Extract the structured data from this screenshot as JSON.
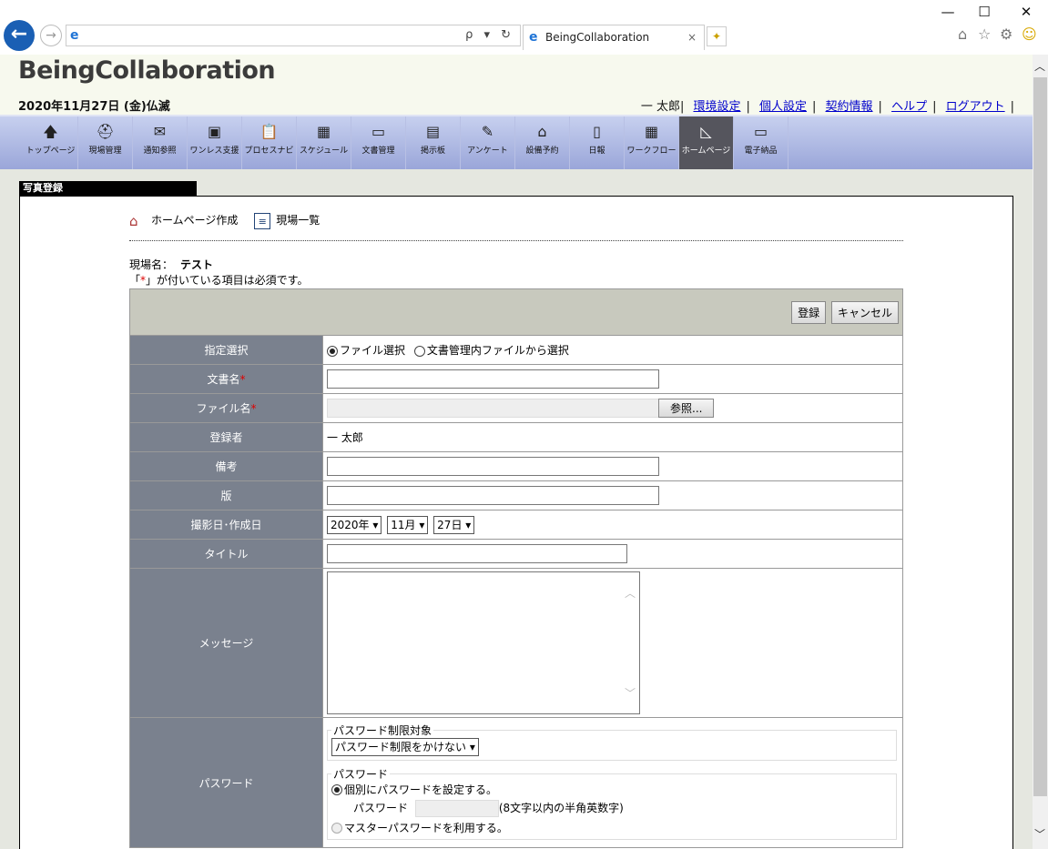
{
  "browser": {
    "tab_title": "BeingCollaboration",
    "address_tools": "ρ ▾ ↻",
    "tab_close": "×",
    "win_min": "—",
    "win_max": "☐",
    "win_close": "✕"
  },
  "app": {
    "logo": "BeingCollaboration",
    "date": "2020年11月27日 (金)仏滅",
    "user": "一 太郎",
    "links": [
      "環境設定",
      "個人設定",
      "契約情報",
      "ヘルプ",
      "ログアウト"
    ]
  },
  "menu": [
    {
      "label": "トップページ",
      "icon": "up-arrow-icon",
      "glyph": "🡅"
    },
    {
      "label": "現場管理",
      "icon": "helmet-icon",
      "glyph": "⛑"
    },
    {
      "label": "通知参照",
      "icon": "mail-icon",
      "glyph": "✉"
    },
    {
      "label": "ワンレス支援",
      "icon": "calendar-day-icon",
      "glyph": "▣"
    },
    {
      "label": "プロセスナビ",
      "icon": "clipboard-icon",
      "glyph": "📋"
    },
    {
      "label": "スケジュール",
      "icon": "calendar-icon",
      "glyph": "▦"
    },
    {
      "label": "文書管理",
      "icon": "folder-icon",
      "glyph": "▭"
    },
    {
      "label": "掲示板",
      "icon": "board-icon",
      "glyph": "▤"
    },
    {
      "label": "アンケート",
      "icon": "pen-icon",
      "glyph": "✎"
    },
    {
      "label": "設備予約",
      "icon": "facility-icon",
      "glyph": "⌂"
    },
    {
      "label": "日報",
      "icon": "document-icon",
      "glyph": "▯"
    },
    {
      "label": "ワークフロー",
      "icon": "grid-icon",
      "glyph": "▦"
    },
    {
      "label": "ホームページ",
      "icon": "triangle-ruler-icon",
      "glyph": "◺"
    },
    {
      "label": "電子納品",
      "icon": "folder-disc-icon",
      "glyph": "▭"
    }
  ],
  "page": {
    "title": "写真登録",
    "link_home": "ホームページ作成",
    "link_sites": "現場一覧",
    "site_label": "現場名：",
    "site_name": "テスト",
    "req_prefix": "「",
    "req_mark": "*",
    "req_suffix": "」が付いている項目は必須です。",
    "btn_register": "登録",
    "btn_cancel": "キャンセル"
  },
  "form": {
    "select_label": "指定選択",
    "opt_file": "ファイル選択",
    "opt_doc": "文書管理内ファイルから選択",
    "docname_label": "文書名",
    "filename_label": "ファイル名",
    "browse": "参照...",
    "registrant_label": "登録者",
    "registrant": "一 太郎",
    "note_label": "備考",
    "version_label": "版",
    "date_label": "撮影日･作成日",
    "year": "2020年",
    "month": "11月",
    "day": "27日",
    "title_label": "タイトル",
    "message_label": "メッセージ",
    "password_label": "パスワード",
    "pw_target_legend": "パスワード制限対象",
    "pw_target_value": "パスワード制限をかけない",
    "pw_legend": "パスワード",
    "pw_individual": "個別にパスワードを設定する。",
    "pw_field_label": "パスワード",
    "pw_hint": "(8文字以内の半角英数字)",
    "pw_master": "マスターパスワードを利用する。",
    "asterisk": "*"
  }
}
